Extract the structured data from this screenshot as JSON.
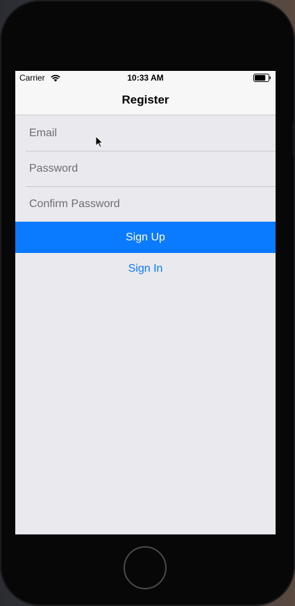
{
  "status_bar": {
    "carrier": "Carrier",
    "time": "10:33 AM",
    "wifi_icon": "wifi-icon",
    "battery_icon": "battery-icon",
    "battery_level": 0.8
  },
  "nav": {
    "title": "Register"
  },
  "form": {
    "email_placeholder": "Email",
    "password_placeholder": "Password",
    "confirm_placeholder": "Confirm Password"
  },
  "buttons": {
    "sign_up": "Sign Up",
    "sign_in": "Sign In"
  },
  "colors": {
    "accent": "#0a7aff",
    "background": "#e9e9ee",
    "bar": "#f7f7f7"
  }
}
